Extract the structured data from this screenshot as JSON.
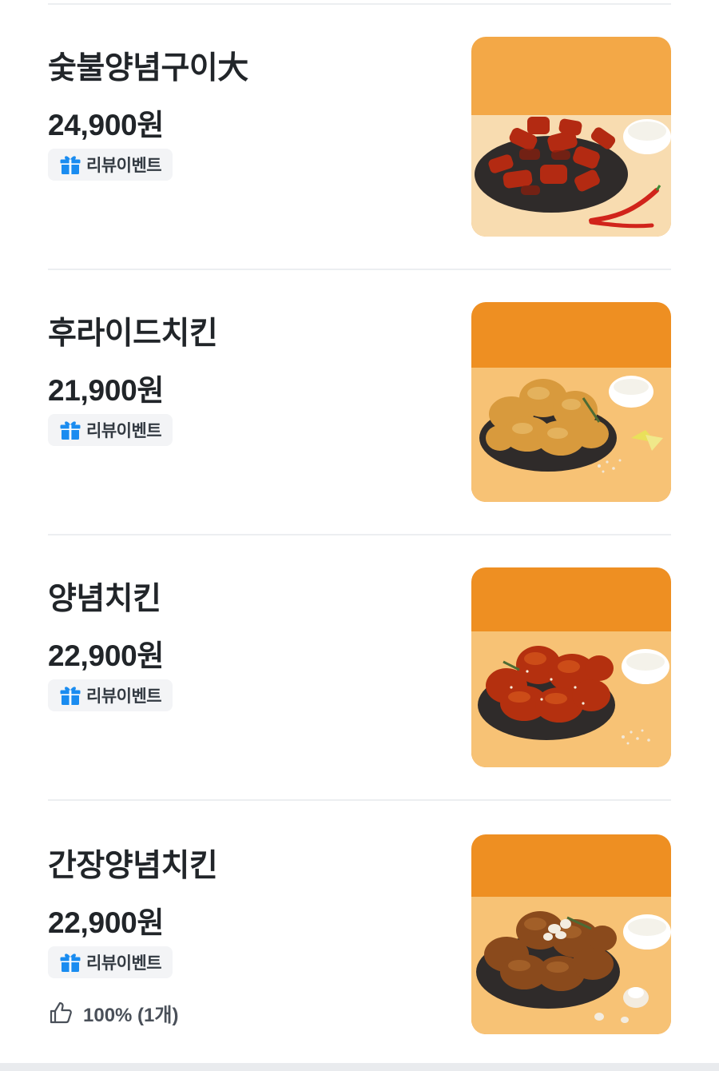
{
  "menu": {
    "items": [
      {
        "name": "숯불양념구이大",
        "price": "24,900원",
        "badge": "리뷰이벤트",
        "image": "sauced-grilled-chicken-photo",
        "theme": "#f1a94a"
      },
      {
        "name": "후라이드치킨",
        "price": "21,900원",
        "badge": "리뷰이벤트",
        "image": "fried-chicken-photo",
        "theme": "#ee9a2e"
      },
      {
        "name": "양념치킨",
        "price": "22,900원",
        "badge": "리뷰이벤트",
        "image": "seasoned-chicken-photo",
        "theme": "#ee9a2e"
      },
      {
        "name": "간장양념치킨",
        "price": "22,900원",
        "badge": "리뷰이벤트",
        "image": "soy-garlic-chicken-photo",
        "theme": "#ee9a2e",
        "rating": "100% (1개)"
      }
    ]
  },
  "colors": {
    "badge_icon": "#1a8cf0",
    "text": "#212529",
    "divider": "#eceef1",
    "badge_bg": "#f3f4f6"
  },
  "icons": {
    "badge": "gift-icon",
    "rating": "thumbs-up-icon"
  }
}
